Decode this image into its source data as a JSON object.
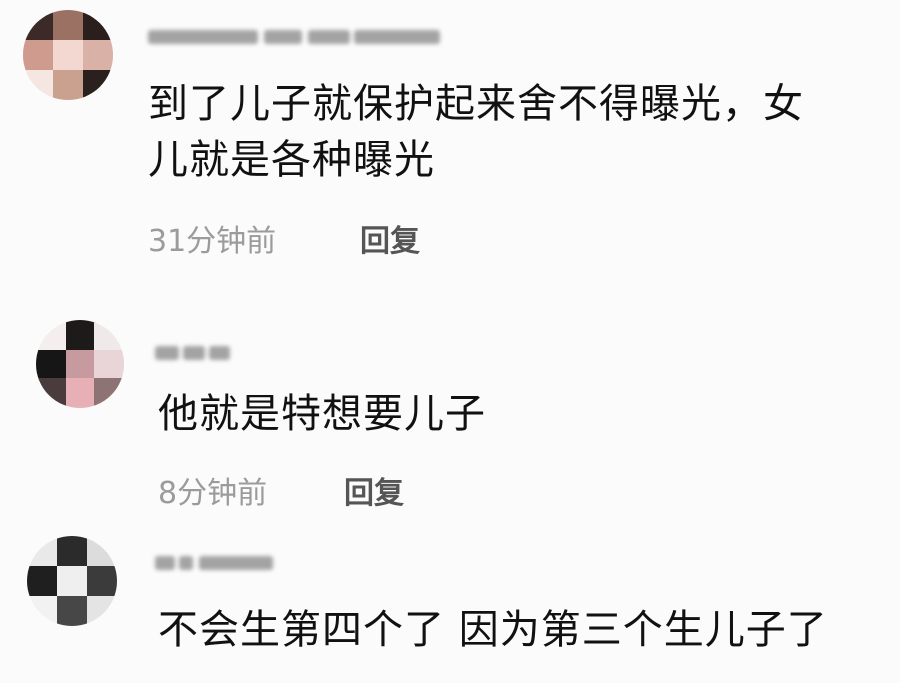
{
  "comments": [
    {
      "text_lines": [
        "到了儿子就保护起来舍不得曝光，女",
        "儿就是各种曝光"
      ],
      "time": "31分钟前",
      "reply_label": "回复"
    },
    {
      "text_lines": [
        "他就是特想要儿子"
      ],
      "time": "8分钟前",
      "reply_label": "回复"
    },
    {
      "text_lines": [
        "不会生第四个了 因为第三个生儿子了"
      ]
    }
  ]
}
